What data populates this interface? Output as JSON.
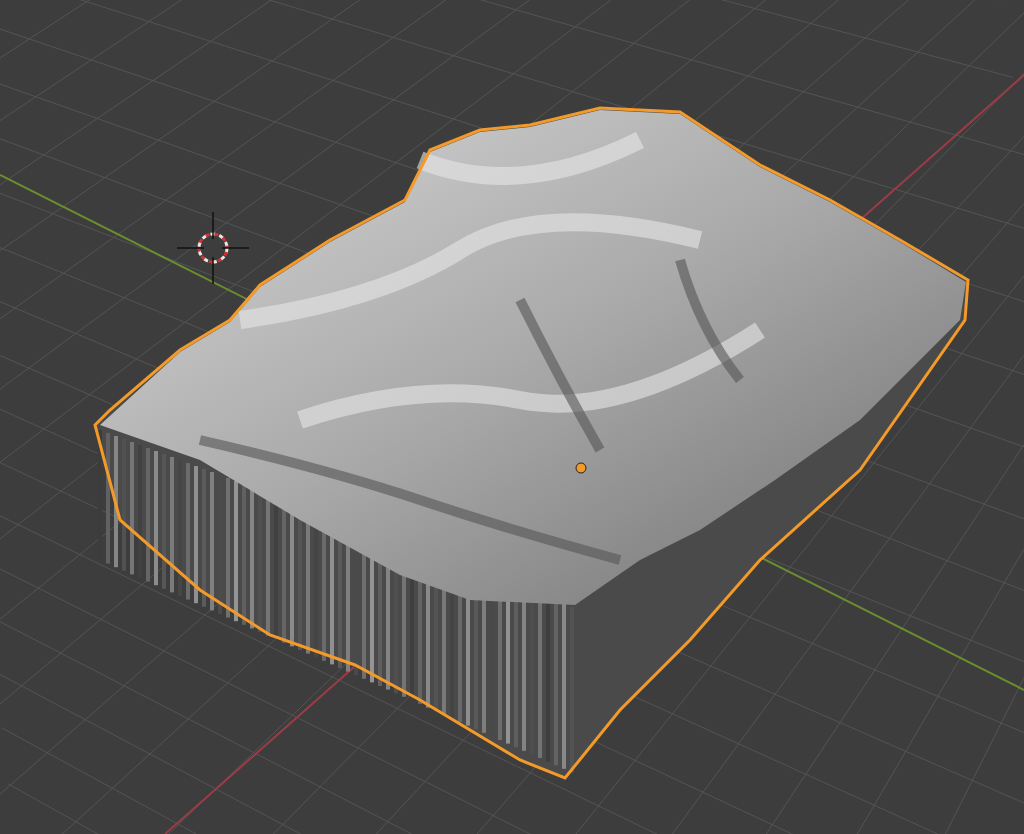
{
  "object": {
    "selected": true
  }
}
